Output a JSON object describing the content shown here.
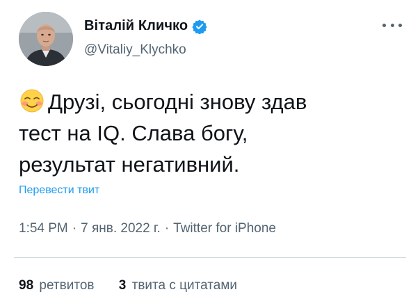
{
  "user": {
    "display_name": "Віталій Кличко",
    "handle": "@Vitaliy_Klychko",
    "verified_icon": "verified-badge-icon"
  },
  "tweet": {
    "emoji": "smiling-face-with-blush-emoji",
    "line1": "Друзі, сьогодні знову здав",
    "line2": "тест на IQ. Слава богу,",
    "line3": "результат негативний."
  },
  "translate_label": "Перевести твит",
  "meta": {
    "time": "1:54 PM",
    "separator": "·",
    "date": "7 янв. 2022 г.",
    "source": "Twitter for iPhone"
  },
  "stats": {
    "retweets_count": "98",
    "retweets_label": "ретвитов",
    "quotes_count": "3",
    "quotes_label": "твита с цитатами"
  },
  "colors": {
    "accent": "#1d9bf0",
    "text": "#0f1419",
    "secondary": "#536471",
    "divider": "#cfd9de"
  }
}
